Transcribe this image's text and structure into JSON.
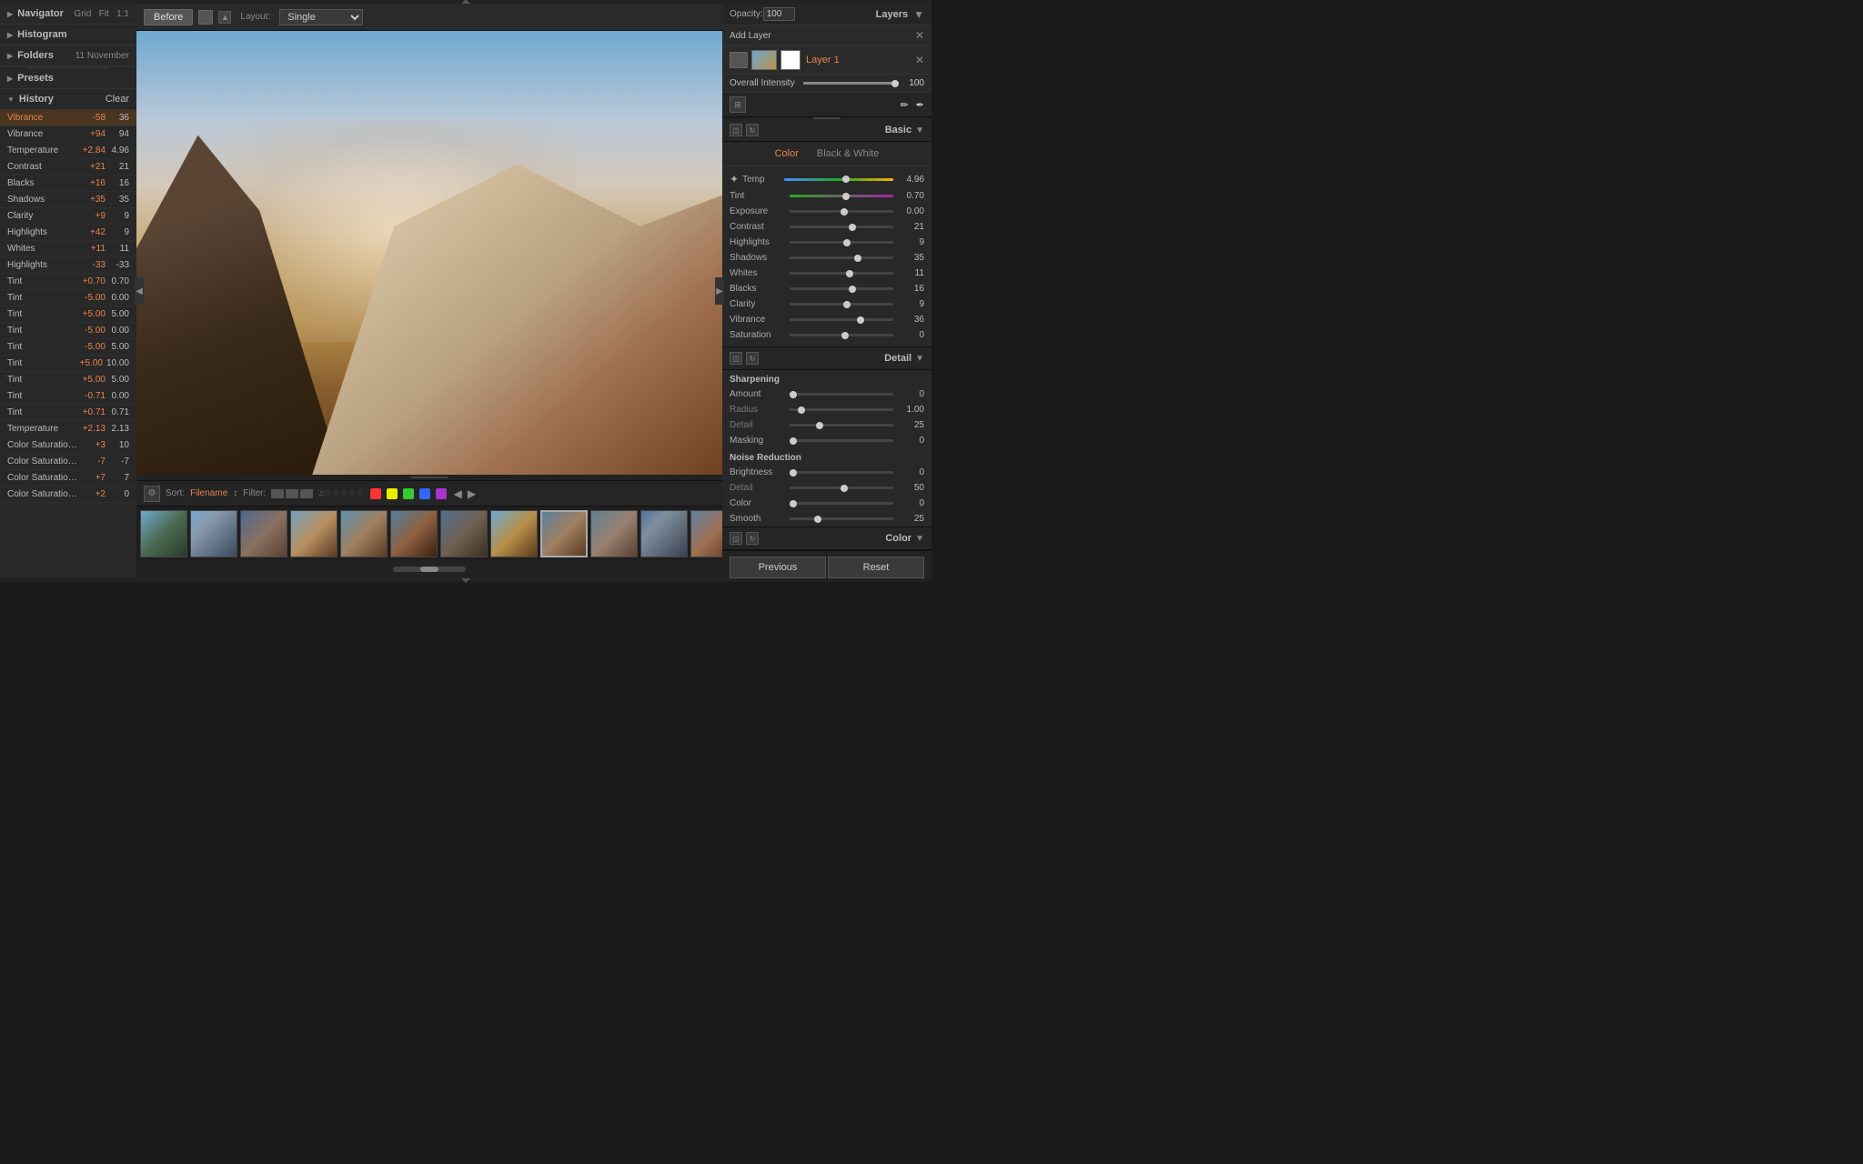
{
  "top_arrow": "▲",
  "left_panel": {
    "navigator": {
      "label": "Navigator",
      "controls": [
        "Grid",
        "Fit",
        "1:1"
      ],
      "collapsed": true
    },
    "histogram": {
      "label": "Histogram",
      "collapsed": true
    },
    "folders": {
      "label": "Folders",
      "extra": "11 November",
      "collapsed": true
    },
    "presets": {
      "label": "Presets",
      "collapsed": true
    },
    "history": {
      "label": "History",
      "clear_label": "Clear",
      "items": [
        {
          "name": "Vibrance",
          "old": "-58",
          "new": "36",
          "active": true
        },
        {
          "name": "Vibrance",
          "old": "+94",
          "new": "94"
        },
        {
          "name": "Temperature",
          "old": "+2.84",
          "new": "4.96"
        },
        {
          "name": "Contrast",
          "old": "+21",
          "new": "21"
        },
        {
          "name": "Blacks",
          "old": "+16",
          "new": "16"
        },
        {
          "name": "Shadows",
          "old": "+35",
          "new": "35"
        },
        {
          "name": "Clarity",
          "old": "+9",
          "new": "9"
        },
        {
          "name": "Highlights",
          "old": "+42",
          "new": "9"
        },
        {
          "name": "Whites",
          "old": "+11",
          "new": "11"
        },
        {
          "name": "Highlights",
          "old": "-33",
          "new": "-33"
        },
        {
          "name": "Tint",
          "old": "+0.70",
          "new": "0.70"
        },
        {
          "name": "Tint",
          "old": "-5.00",
          "new": "0.00"
        },
        {
          "name": "Tint",
          "old": "+5.00",
          "new": "5.00"
        },
        {
          "name": "Tint",
          "old": "-5.00",
          "new": "0.00"
        },
        {
          "name": "Tint",
          "old": "-5.00",
          "new": "5.00"
        },
        {
          "name": "Tint",
          "old": "+5.00",
          "new": "10.00"
        },
        {
          "name": "Tint",
          "old": "+5.00",
          "new": "5.00"
        },
        {
          "name": "Tint",
          "old": "-0.71",
          "new": "0.00"
        },
        {
          "name": "Tint",
          "old": "+0.71",
          "new": "0.71"
        },
        {
          "name": "Temperature",
          "old": "+2.13",
          "new": "2.13"
        },
        {
          "name": "Color Saturation Sha...",
          "old": "+3",
          "new": "10"
        },
        {
          "name": "Color Saturation Hig...",
          "old": "-7",
          "new": "-7"
        },
        {
          "name": "Color Saturation Sha...",
          "old": "+7",
          "new": "7"
        },
        {
          "name": "Color Saturation Midt...",
          "old": "+2",
          "new": "0"
        }
      ]
    }
  },
  "viewer": {
    "before_label": "Before",
    "layout_label": "Layout:",
    "layout_value": "Single"
  },
  "filmstrip_toolbar": {
    "sort_label": "Sort:",
    "sort_value": "Filename",
    "filter_label": "Filter:",
    "stars": "☆☆☆☆☆",
    "nav_left": "◀",
    "nav_right": "▶"
  },
  "right_panel": {
    "opacity_label": "Opacity:",
    "opacity_value": "100",
    "layers_label": "Layers",
    "add_layer_label": "Add Layer",
    "layer_name": "Layer 1",
    "overall_intensity_label": "Overall Intensity",
    "overall_intensity_value": "100",
    "basic_label": "Basic",
    "color_tab": "Color",
    "bw_tab": "Black & White",
    "sliders": {
      "temp": {
        "label": "Temp",
        "value": "4.96",
        "percent": 55
      },
      "tint": {
        "label": "Tint",
        "value": "0.70",
        "percent": 52
      },
      "exposure": {
        "label": "Exposure",
        "value": "0.00",
        "percent": 50
      },
      "contrast": {
        "label": "Contrast",
        "value": "21",
        "percent": 58
      },
      "highlights": {
        "label": "Highlights",
        "value": "9",
        "percent": 52
      },
      "shadows": {
        "label": "Shadows",
        "value": "35",
        "percent": 62
      },
      "whites": {
        "label": "Whites",
        "value": "11",
        "percent": 54
      },
      "blacks": {
        "label": "Blacks",
        "value": "16",
        "percent": 57
      },
      "clarity": {
        "label": "Clarity",
        "value": "9",
        "percent": 52
      },
      "vibrance": {
        "label": "Vibrance",
        "value": "36",
        "percent": 65
      },
      "saturation": {
        "label": "Saturation",
        "value": "0",
        "percent": 50
      }
    },
    "detail_label": "Detail",
    "sharpening_label": "Sharpening",
    "sharpening_sliders": {
      "amount": {
        "label": "Amount",
        "value": "0",
        "percent": 0
      },
      "radius": {
        "label": "Radius",
        "value": "1.00",
        "percent": 10
      },
      "detail": {
        "label": "Detail",
        "value": "25",
        "percent": 25
      },
      "masking": {
        "label": "Masking",
        "value": "0",
        "percent": 0
      }
    },
    "noise_reduction_label": "Noise Reduction",
    "noise_sliders": {
      "brightness": {
        "label": "Brightness",
        "value": "0",
        "percent": 0
      },
      "detail": {
        "label": "Detail",
        "value": "50",
        "percent": 50
      },
      "color": {
        "label": "Color",
        "value": "0",
        "percent": 0
      },
      "smooth": {
        "label": "Smooth",
        "value": "25",
        "percent": 25
      }
    },
    "color_section_label": "Color",
    "buttons": {
      "previous": "Previous",
      "reset": "Reset"
    }
  }
}
